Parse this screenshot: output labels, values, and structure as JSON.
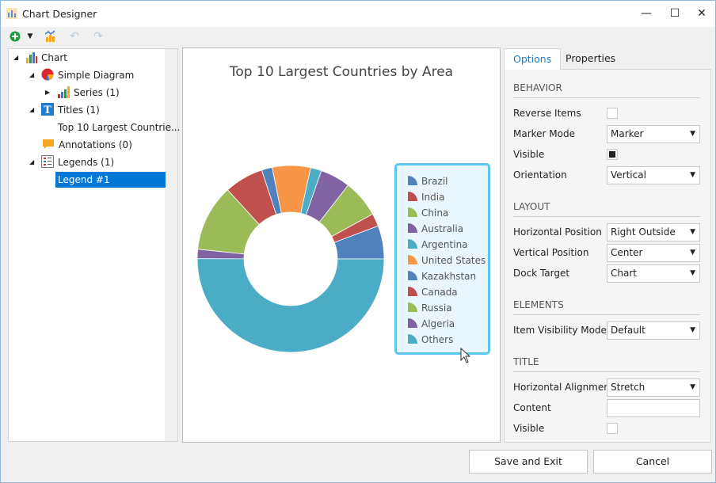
{
  "window": {
    "title": "Chart Designer"
  },
  "tree": [
    {
      "label": "Chart",
      "icon": "bar-chart-icon"
    },
    {
      "label": "Simple Diagram",
      "icon": "pie-chart-icon"
    },
    {
      "label": "Series (1)",
      "icon": "series-icon"
    },
    {
      "label": "Titles (1)",
      "icon": "title-icon"
    },
    {
      "label": "Top 10 Largest Countrie..."
    },
    {
      "label": "Annotations (0)",
      "icon": "annotation-icon"
    },
    {
      "label": "Legends (1)",
      "icon": "legend-icon"
    },
    {
      "label": "Legend #1",
      "selected": true
    }
  ],
  "chart_data": {
    "type": "pie",
    "donut": true,
    "title": "Top 10 Largest Countries by Area",
    "categories": [
      "Brazil",
      "India",
      "China",
      "Australia",
      "Argentina",
      "United States",
      "Kazakhstan",
      "Canada",
      "Russia",
      "Algeria",
      "Others"
    ],
    "values": [
      8.5,
      3.3,
      9.6,
      7.7,
      2.8,
      9.8,
      2.7,
      10.0,
      17.1,
      2.4,
      74.0
    ],
    "colors": [
      "#4f81bd",
      "#c0504d",
      "#9bbb59",
      "#8064a2",
      "#4bacc6",
      "#f79646",
      "#4f81bd",
      "#c0504d",
      "#9bbb59",
      "#8064a2",
      "#4bacc6"
    ],
    "legend_placement": "right-outside"
  },
  "panel": {
    "tabs": [
      "Options",
      "Properties"
    ],
    "sections": {
      "behavior": "BEHAVIOR",
      "layout": "LAYOUT",
      "elements": "ELEMENTS",
      "title": "TITLE"
    },
    "reverse_items": {
      "label": "Reverse Items",
      "checked": false
    },
    "marker_mode": {
      "label": "Marker Mode",
      "value": "Marker"
    },
    "visible": {
      "label": "Visible",
      "checked": true
    },
    "orientation": {
      "label": "Orientation",
      "value": "Vertical"
    },
    "horizontal_position": {
      "label": "Horizontal Position",
      "value": "Right Outside"
    },
    "vertical_position": {
      "label": "Vertical Position",
      "value": "Center"
    },
    "dock_target": {
      "label": "Dock Target",
      "value": "Chart"
    },
    "item_visibility_mode": {
      "label": "Item Visibility Mode",
      "value": "Default"
    },
    "horizontal_alignment": {
      "label": "Horizontal Alignment",
      "value": "Stretch"
    },
    "content": {
      "label": "Content",
      "value": ""
    },
    "title_visible": {
      "label": "Visible",
      "checked": false
    }
  },
  "buttons": {
    "save": "Save and Exit",
    "cancel": "Cancel"
  }
}
